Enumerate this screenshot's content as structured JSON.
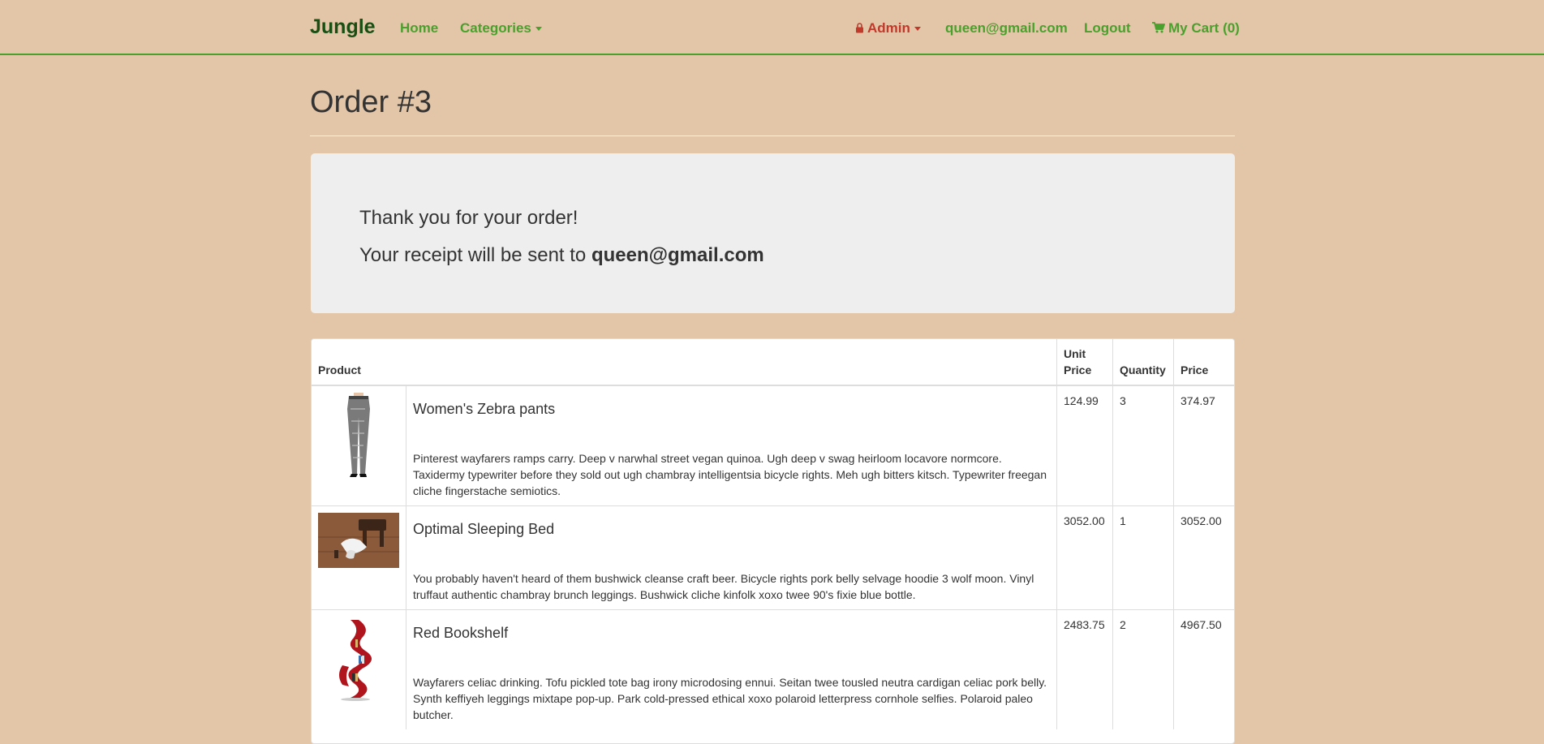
{
  "nav": {
    "brand": "Jungle",
    "home": "Home",
    "categories": "Categories",
    "admin": "Admin",
    "email": "queen@gmail.com",
    "logout": "Logout",
    "cart": "My Cart (0)",
    "colors": {
      "accent": "#4aa02c",
      "brand": "#1a4f14",
      "admin": "#c0392b"
    }
  },
  "page": {
    "title": "Order #3"
  },
  "notice": {
    "thanks": "Thank you for your order!",
    "receipt_prefix": "Your receipt will be sent to ",
    "receipt_email": "queen@gmail.com"
  },
  "table": {
    "headers": {
      "product": "Product",
      "unit_price": "Unit Price",
      "quantity": "Quantity",
      "price": "Price"
    },
    "rows": [
      {
        "image": "pants-photo",
        "name": "Women's Zebra pants",
        "description": "Pinterest wayfarers ramps carry. Deep v narwhal street vegan quinoa. Ugh deep v swag heirloom locavore normcore. Taxidermy typewriter before they sold out ugh chambray intelligentsia bicycle rights. Meh ugh bitters kitsch. Typewriter freegan cliche fingerstache semiotics.",
        "unit_price": "124.99",
        "quantity": "3",
        "price": "374.97"
      },
      {
        "image": "bed-photo",
        "name": "Optimal Sleeping Bed",
        "description": "You probably haven't heard of them bushwick cleanse craft beer. Bicycle rights pork belly selvage hoodie 3 wolf moon. Vinyl truffaut authentic chambray brunch leggings. Bushwick cliche kinfolk xoxo twee 90's fixie blue bottle.",
        "unit_price": "3052.00",
        "quantity": "1",
        "price": "3052.00"
      },
      {
        "image": "bookshelf-photo",
        "name": "Red Bookshelf",
        "description": "Wayfarers celiac drinking. Tofu pickled tote bag irony microdosing ennui. Seitan twee tousled neutra cardigan celiac pork belly. Synth keffiyeh leggings mixtape pop-up. Park cold-pressed ethical xoxo polaroid letterpress cornhole selfies. Polaroid paleo butcher.",
        "unit_price": "2483.75",
        "quantity": "2",
        "price": "4967.50"
      }
    ]
  }
}
